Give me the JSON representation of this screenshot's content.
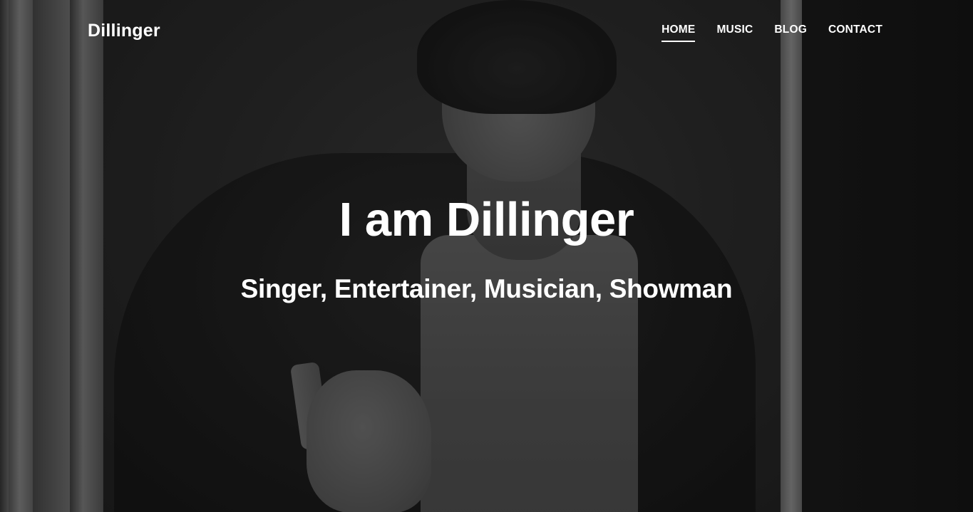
{
  "header": {
    "brand": "Dillinger"
  },
  "nav": {
    "items": [
      {
        "label": "HOME",
        "active": true
      },
      {
        "label": "MUSIC",
        "active": false
      },
      {
        "label": "BLOG",
        "active": false
      },
      {
        "label": "CONTACT",
        "active": false
      }
    ]
  },
  "hero": {
    "title": "I am Dillinger",
    "subtitle": "Singer, Entertainer, Musician, Showman"
  },
  "colors": {
    "text": "#ffffff",
    "overlay": "#000000"
  }
}
